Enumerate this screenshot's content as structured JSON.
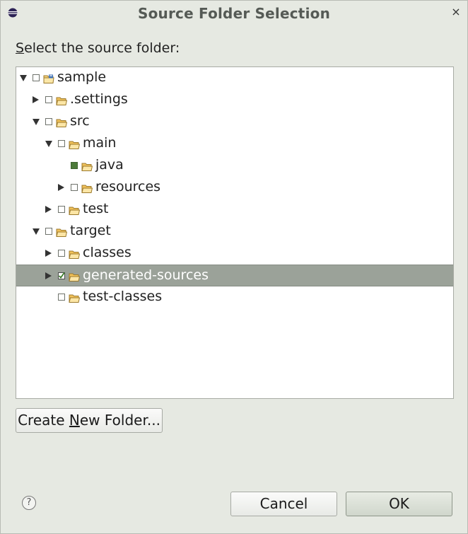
{
  "window": {
    "title": "Source Folder Selection",
    "close_glyph": "×",
    "icon": "eclipse-icon"
  },
  "prompt": {
    "mnemonic": "S",
    "rest": "elect the source folder:"
  },
  "tree": {
    "items": [
      {
        "label": "sample",
        "level": 0,
        "expander": "down",
        "check": "empty",
        "icon": "project-folder-icon"
      },
      {
        "label": ".settings",
        "level": 1,
        "expander": "right",
        "check": "empty",
        "icon": "folder-icon"
      },
      {
        "label": "src",
        "level": 1,
        "expander": "down",
        "check": "empty",
        "icon": "folder-icon"
      },
      {
        "label": "main",
        "level": 2,
        "expander": "down",
        "check": "empty",
        "icon": "folder-icon"
      },
      {
        "label": "java",
        "level": 3,
        "expander": "none",
        "check": "partial",
        "icon": "folder-icon"
      },
      {
        "label": "resources",
        "level": 3,
        "expander": "right",
        "check": "empty",
        "icon": "folder-icon"
      },
      {
        "label": "test",
        "level": 2,
        "expander": "right",
        "check": "empty",
        "icon": "folder-icon"
      },
      {
        "label": "target",
        "level": 1,
        "expander": "down",
        "check": "empty",
        "icon": "folder-icon"
      },
      {
        "label": "classes",
        "level": 2,
        "expander": "right",
        "check": "empty",
        "icon": "folder-icon"
      },
      {
        "label": "generated-sources",
        "level": 2,
        "expander": "right",
        "check": "checked",
        "icon": "folder-icon",
        "selected": true
      },
      {
        "label": "test-classes",
        "level": 2,
        "expander": "none",
        "check": "empty",
        "icon": "folder-icon"
      }
    ]
  },
  "buttons": {
    "create_pre": "Create ",
    "create_mnemonic": "N",
    "create_post": "ew Folder...",
    "cancel": "Cancel",
    "ok": "OK",
    "help": "?"
  },
  "colors": {
    "selection": "#9ba299",
    "partial_check": "#4c7a3a",
    "folder": "#f0b345"
  }
}
